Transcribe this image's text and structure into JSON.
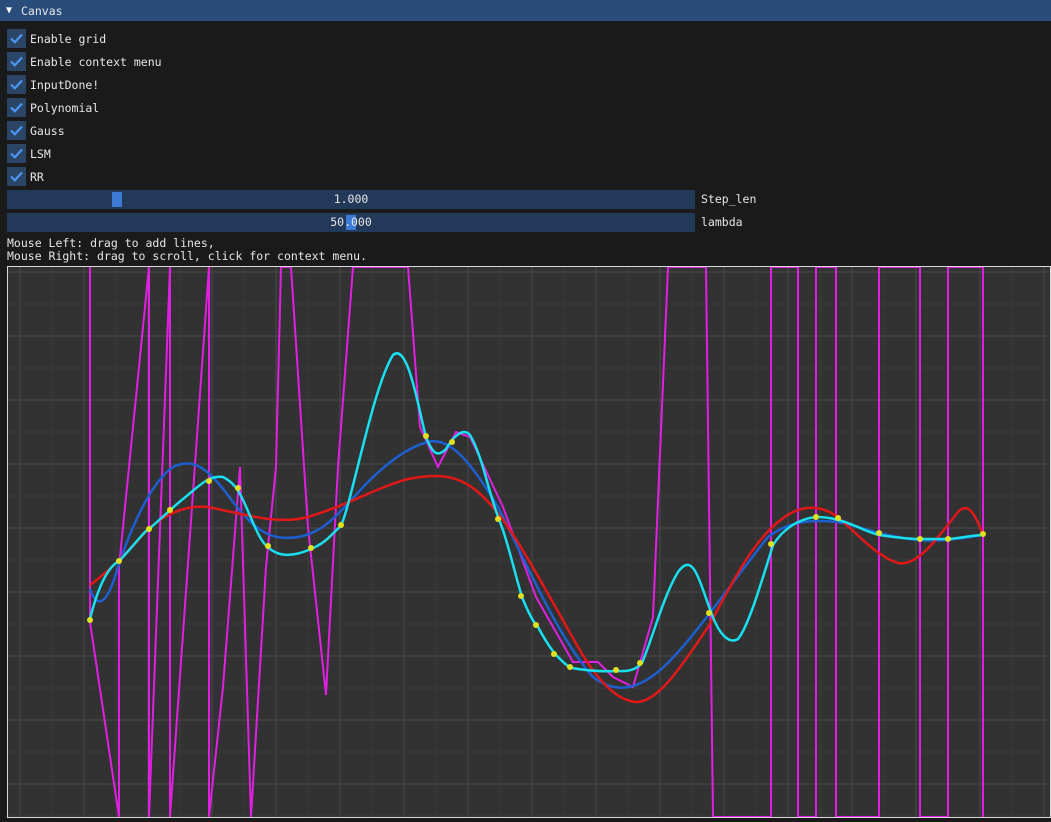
{
  "window": {
    "title": "Canvas"
  },
  "options": [
    {
      "label": "Enable grid",
      "checked": true
    },
    {
      "label": "Enable context menu",
      "checked": true
    },
    {
      "label": "InputDone!",
      "checked": true
    },
    {
      "label": "Polynomial",
      "checked": true
    },
    {
      "label": "Gauss",
      "checked": true
    },
    {
      "label": "LSM",
      "checked": true
    },
    {
      "label": "RR",
      "checked": true
    }
  ],
  "sliders": [
    {
      "label": "Step_len",
      "value": "1.000",
      "fraction": 0.155
    },
    {
      "label": "lambda",
      "value": "50.000",
      "fraction": 0.5
    }
  ],
  "help": {
    "line1": "Mouse Left: drag to add lines,",
    "line2": "Mouse Right: drag to scroll, click for context menu."
  },
  "colors": {
    "polynomial": "#e020e0",
    "gauss": "#1e5fd0",
    "lsm": "#e01818",
    "rr": "#18e0f0",
    "points": "#e0e020",
    "accent": "#3d7ad6"
  }
}
